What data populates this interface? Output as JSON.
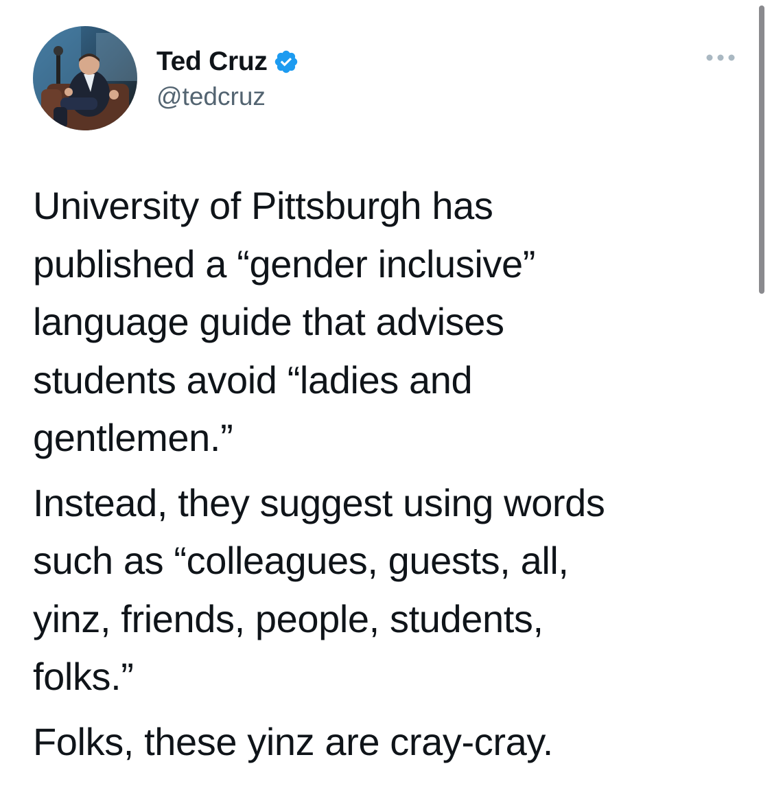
{
  "tweet": {
    "author": {
      "display_name": "Ted Cruz",
      "handle": "@tedcruz",
      "verified": true,
      "avatar_icon": "profile-photo"
    },
    "more_icon": "ellipsis-icon",
    "paragraphs": [
      "University of Pittsburgh has\npublished a “gender inclusive”\nlanguage guide that advises\nstudents avoid “ladies and\ngentlemen.”",
      "Instead, they suggest using words\nsuch as “colleagues, guests, all,\nyinz, friends, people, students,\nfolks.”",
      "Folks, these yinz are cray-cray."
    ]
  },
  "colors": {
    "text": "#0f1419",
    "secondary_text": "#536471",
    "verified_blue": "#1d9bf0",
    "more_dots": "#aab8c2",
    "scrollbar": "#8a8a8e"
  }
}
